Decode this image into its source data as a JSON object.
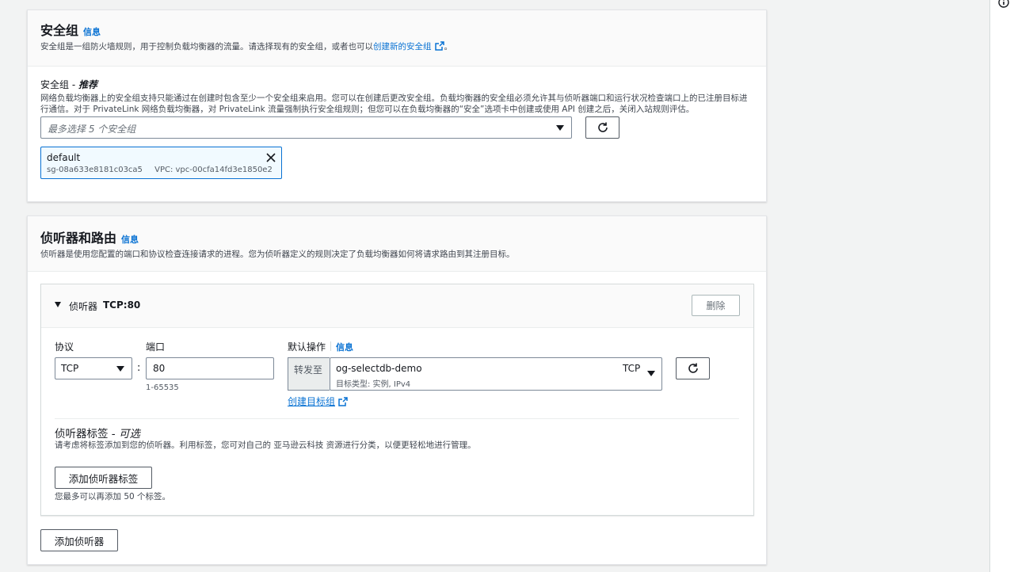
{
  "security_groups": {
    "title": "安全组",
    "info_link": "信息",
    "description_prefix": "安全组是一组防火墙规则，用于控制负载均衡器的流量。请选择现有的安全组，或者也可以",
    "create_link": "创建新的安全组",
    "description_suffix": "。",
    "field_label": "安全组 - ",
    "field_label_emphasis": "推荐",
    "field_help": "网络负载均衡器上的安全组支持只能通过在创建时包含至少一个安全组来启用。您可以在创建后更改安全组。负载均衡器的安全组必须允许其与侦听器端口和运行状况检查端口上的已注册目标进行通信。对于 PrivateLink 网络负载均衡器，对 PrivateLink 流量强制执行安全组规则；但您可以在负载均衡器的“安全”选项卡中创建或使用 API 创建之后，关闭入站规则评估。",
    "select_placeholder": "最多选择 5 个安全组",
    "selected": {
      "name": "default",
      "id": "sg-08a633e8181c03ca5",
      "vpc": "VPC: vpc-00cfa14fd3e1850e2"
    }
  },
  "listeners": {
    "title": "侦听器和路由",
    "info_link": "信息",
    "description": "侦听器是使用您配置的端口和协议检查连接请求的进程。您为侦听器定义的规则决定了负载均衡器如何将请求路由到其注册目标。",
    "listener_title": "侦听器",
    "listener_id": "TCP:80",
    "delete_button": "删除",
    "protocol_label": "协议",
    "protocol_value": "TCP",
    "colon": ":",
    "port_label": "端口",
    "port_value": "80",
    "port_hint": "1-65535",
    "default_action_label": "默认操作",
    "default_action_info": "信息",
    "forward_to": "转发至",
    "target_group_name": "og-selectdb-demo",
    "target_group_protocol": "TCP",
    "target_group_meta": "目标类型: 实例, IPv4",
    "create_target_group_link": "创建目标组",
    "tags_label": "侦听器标签 - ",
    "tags_label_emphasis": "可选",
    "tags_help": "请考虑将标签添加到您的侦听器。利用标签，您可对自己的 亚马逊云科技 资源进行分类，以便更轻松地进行管理。",
    "add_tag_button": "添加侦听器标签",
    "tag_limit": "您最多可以再添加 50 个标签。",
    "add_listener_button": "添加侦听器"
  },
  "icons": {
    "external": "external-link-icon",
    "refresh": "refresh-icon",
    "close": "close-icon",
    "caret": "caret-down-icon",
    "info": "info-icon"
  },
  "colors": {
    "link": "#0972d3",
    "selected_bg": "#f1faff"
  }
}
